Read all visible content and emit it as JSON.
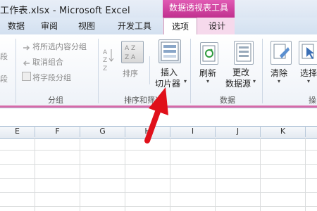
{
  "titlebar": {
    "title": "工作表.xlsx - Microsoft Excel",
    "context_group": "数据透视表工具"
  },
  "tabs": [
    {
      "label": "数据"
    },
    {
      "label": "审阅"
    },
    {
      "label": "视图"
    },
    {
      "label": "开发工具"
    },
    {
      "label": "选项",
      "active": true
    },
    {
      "label": "设计"
    }
  ],
  "ribbon": {
    "group_partial_left": {
      "items": [
        "段",
        "段"
      ]
    },
    "group_outline": {
      "items": [
        "将所选内容分组",
        "取消组合",
        "将字段分组"
      ],
      "label": "分组"
    },
    "group_sort": {
      "sort_label": "排序",
      "insert_slicer_line1": "插入",
      "insert_slicer_line2": "切片器",
      "label": "排序和筛选"
    },
    "group_data": {
      "refresh_label": "刷新",
      "change_source_line1": "更改",
      "change_source_line2": "数据源",
      "label": "数据"
    },
    "group_actions": {
      "clear_label": "清除",
      "select_label": "选择",
      "label_partial": "操"
    }
  },
  "sheet": {
    "columns": [
      "E",
      "F",
      "G",
      "H",
      "I",
      "J",
      "K"
    ]
  },
  "colors": {
    "context_pink": "#c1308f",
    "annotation_arrow": "#e0101a"
  }
}
